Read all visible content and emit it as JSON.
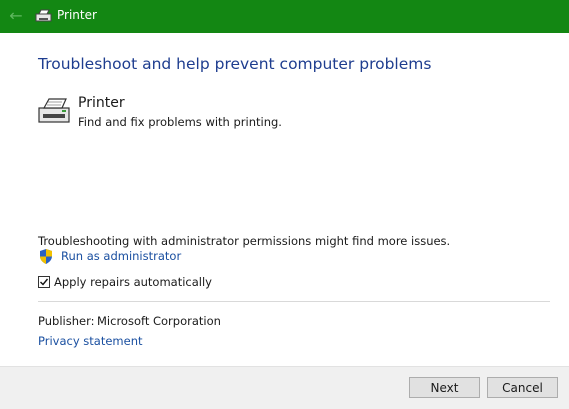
{
  "titlebar": {
    "title": "Printer",
    "accent_color": "#138713",
    "back_icon": "back-arrow-icon",
    "app_icon": "printer-icon"
  },
  "main": {
    "heading": "Troubleshoot and help prevent computer problems",
    "tool": {
      "name": "Printer",
      "description": "Find and fix problems with printing.",
      "icon": "printer-icon"
    },
    "admin_note": "Troubleshooting with administrator permissions might find more issues.",
    "run_as_admin": {
      "label": "Run as administrator",
      "icon": "uac-shield-icon"
    },
    "apply_repairs": {
      "label": "Apply repairs automatically",
      "checked": true
    },
    "publisher_label": "Publisher:",
    "publisher_value": "Microsoft Corporation",
    "privacy_link": "Privacy statement"
  },
  "footer": {
    "next_label": "Next",
    "cancel_label": "Cancel"
  }
}
